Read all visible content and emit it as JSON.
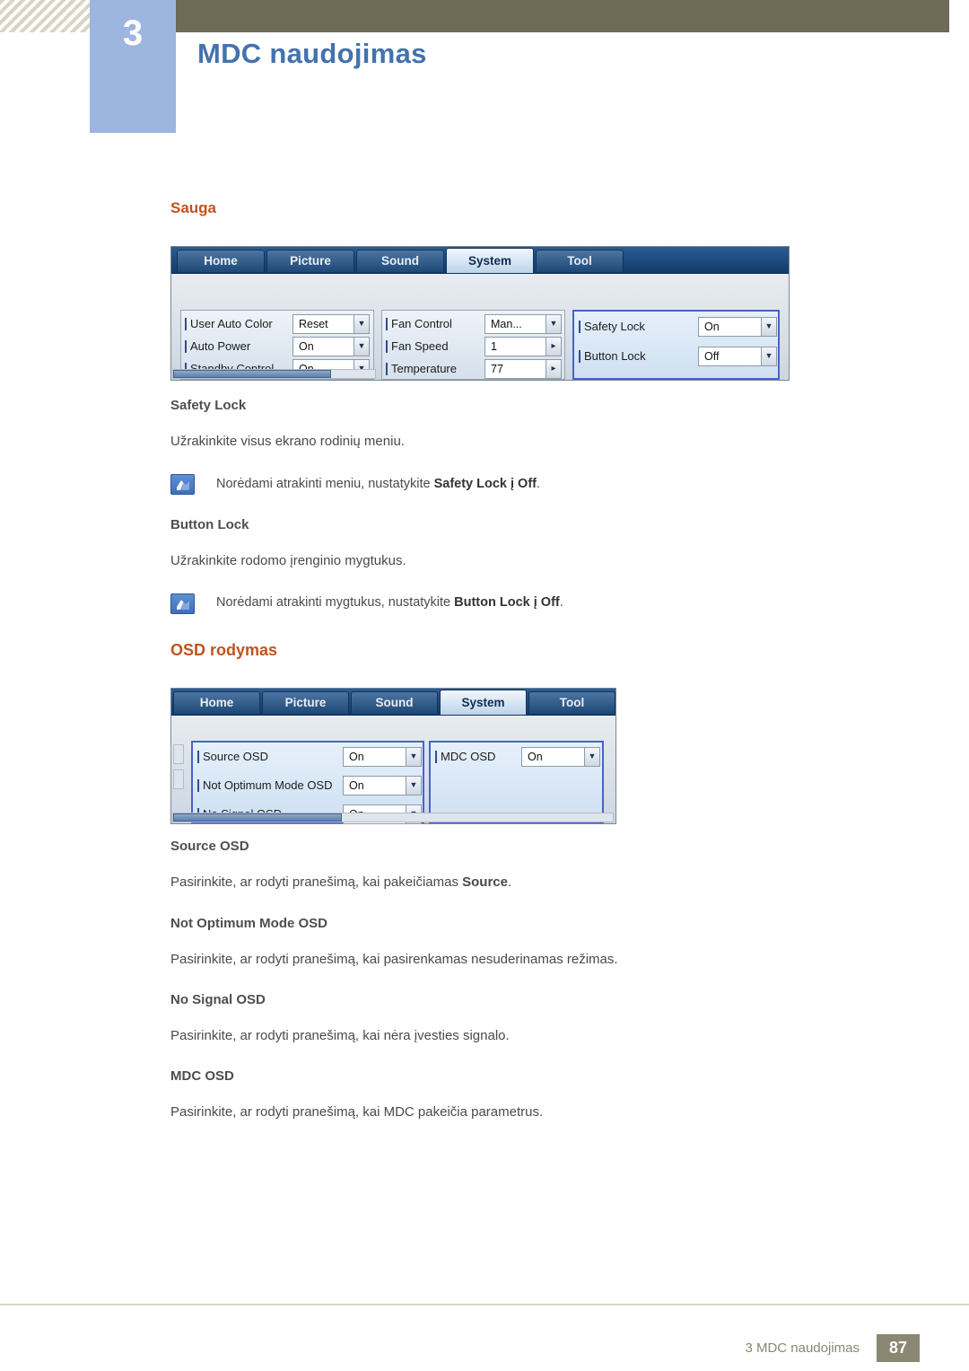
{
  "header": {
    "chapter_number": "3",
    "chapter_title": "MDC naudojimas"
  },
  "sections": {
    "sauga": {
      "heading": "Sauga",
      "safety_lock": {
        "subhead": "Safety Lock",
        "para": "Užrakinkite visus ekrano rodinių meniu.",
        "note_pre": "Norėdami atrakinti meniu, nustatykite ",
        "note_bold": "Safety Lock į Off",
        "note_post": "."
      },
      "button_lock": {
        "subhead": "Button Lock",
        "para": "Užrakinkite rodomo įrenginio mygtukus.",
        "note_pre": "Norėdami atrakinti mygtukus, nustatykite ",
        "note_bold": "Button Lock į Off",
        "note_post": "."
      }
    },
    "osd": {
      "heading": "OSD rodymas",
      "items": [
        {
          "subhead": "Source OSD",
          "para_pre": "Pasirinkite, ar rodyti pranešimą, kai pakeičiamas ",
          "para_bold": "Source",
          "para_post": "."
        },
        {
          "subhead": "Not Optimum Mode OSD",
          "para_pre": "Pasirinkite, ar rodyti pranešimą, kai pasirenkamas nesuderinamas režimas.",
          "para_bold": "",
          "para_post": ""
        },
        {
          "subhead": "No Signal OSD",
          "para_pre": "Pasirinkite, ar rodyti pranešimą, kai nėra įvesties signalo.",
          "para_bold": "",
          "para_post": ""
        },
        {
          "subhead": "MDC OSD",
          "para_pre": "Pasirinkite, ar rodyti pranešimą, kai MDC pakeičia parametrus.",
          "para_bold": "",
          "para_post": ""
        }
      ]
    }
  },
  "mdc_window_1": {
    "tabs": [
      {
        "label": "Home",
        "active": false
      },
      {
        "label": "Picture",
        "active": false
      },
      {
        "label": "Sound",
        "active": false
      },
      {
        "label": "System",
        "active": true
      },
      {
        "label": "Tool",
        "active": false
      }
    ],
    "panel_left": [
      {
        "label": "User Auto Color",
        "value": "Reset",
        "type": "dropdown"
      },
      {
        "label": "Auto Power",
        "value": "On",
        "type": "dropdown"
      },
      {
        "label": "Standby Control",
        "value": "On",
        "type": "dropdown"
      }
    ],
    "panel_mid": [
      {
        "label": "Fan Control",
        "value": "Man...",
        "type": "dropdown"
      },
      {
        "label": "Fan Speed",
        "value": "1",
        "type": "spinner"
      },
      {
        "label": "Temperature",
        "value": "77",
        "type": "spinner"
      }
    ],
    "panel_right": [
      {
        "label": "Safety Lock",
        "value": "On",
        "type": "dropdown"
      },
      {
        "label": "Button Lock",
        "value": "Off",
        "type": "dropdown"
      }
    ]
  },
  "mdc_window_2": {
    "tabs": [
      {
        "label": "Home",
        "active": false
      },
      {
        "label": "Picture",
        "active": false
      },
      {
        "label": "Sound",
        "active": false
      },
      {
        "label": "System",
        "active": true
      },
      {
        "label": "Tool",
        "active": false
      }
    ],
    "panel_left": [
      {
        "label": "Source OSD",
        "value": "On",
        "type": "dropdown"
      },
      {
        "label": "Not Optimum Mode OSD",
        "value": "On",
        "type": "dropdown"
      },
      {
        "label": "No Signal OSD",
        "value": "On",
        "type": "dropdown"
      }
    ],
    "panel_right": [
      {
        "label": "MDC OSD",
        "value": "On",
        "type": "dropdown"
      }
    ]
  },
  "footer": {
    "text": "3 MDC naudojimas",
    "page": "87"
  },
  "colors": {
    "heading_orange": "#c0531f",
    "chapter_blue": "#4472ad",
    "header_olive": "#6f6a55",
    "selection_blue": "#4763c8"
  }
}
